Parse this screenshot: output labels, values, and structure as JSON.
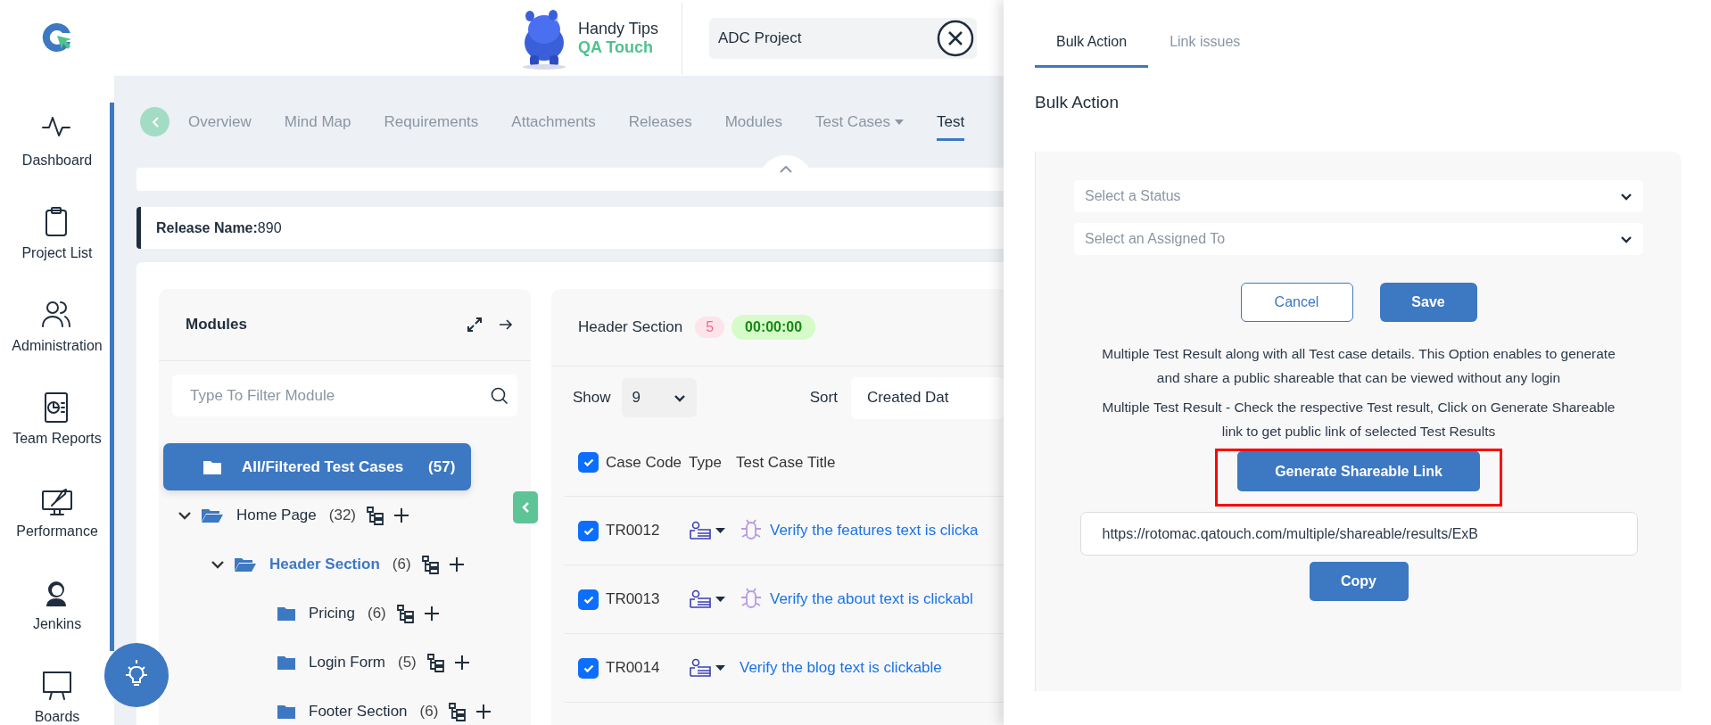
{
  "sidebar": {
    "items": [
      {
        "label": "Dashboard"
      },
      {
        "label": "Project List"
      },
      {
        "label": "Administration"
      },
      {
        "label": "Team Reports"
      },
      {
        "label": "Performance"
      },
      {
        "label": "Jenkins"
      },
      {
        "label": "Boards"
      }
    ]
  },
  "header": {
    "title": "Handy Tips",
    "subtitle": "QA Touch",
    "project_field": {
      "value": "ADC Project"
    }
  },
  "nav_tabs": [
    {
      "label": "Overview",
      "selected": false,
      "dropdown": false
    },
    {
      "label": "Mind Map",
      "selected": false,
      "dropdown": false
    },
    {
      "label": "Requirements",
      "selected": false,
      "dropdown": false
    },
    {
      "label": "Attachments",
      "selected": false,
      "dropdown": false
    },
    {
      "label": "Releases",
      "selected": false,
      "dropdown": false
    },
    {
      "label": "Modules",
      "selected": false,
      "dropdown": false
    },
    {
      "label": "Test Cases",
      "selected": false,
      "dropdown": true
    },
    {
      "label": "Test",
      "selected": true,
      "dropdown": false
    }
  ],
  "release": {
    "label": "Release Name:",
    "value": "890"
  },
  "modules": {
    "title": "Modules",
    "filter": {
      "placeholder": "Type To Filter Module"
    },
    "tree": [
      {
        "kind": "summary",
        "label": "All/Filtered Test Cases",
        "count": "(57)",
        "selected": true
      },
      {
        "kind": "module",
        "label": "Home Page",
        "count": "(32)",
        "selected": false,
        "active": false,
        "expanded": true,
        "children": [
          {
            "kind": "module",
            "label": "Header Section",
            "count": "(6)",
            "selected": false,
            "active": true,
            "expanded": true,
            "children": [
              {
                "kind": "module",
                "label": "Pricing",
                "count": "(6)",
                "selected": false,
                "active": false
              },
              {
                "kind": "module",
                "label": "Login Form",
                "count": "(5)",
                "selected": false,
                "active": false
              },
              {
                "kind": "module",
                "label": "Footer Section",
                "count": "(6)",
                "selected": false,
                "active": false
              }
            ]
          }
        ]
      }
    ]
  },
  "test_list": {
    "title": "Header Section",
    "count": "5",
    "timer": "00:00:00",
    "show": {
      "label": "Show",
      "value": "9"
    },
    "sort": {
      "label": "Sort",
      "value": "Created Dat"
    },
    "header_checked": true,
    "columns": [
      "Case Code",
      "Type",
      "Test Case Title"
    ],
    "rows": [
      {
        "code": "TR0012",
        "checked": true,
        "bug": true,
        "title": "Verify the features text is clicka"
      },
      {
        "code": "TR0013",
        "checked": true,
        "bug": true,
        "title": "Verify the about text is clickabl"
      },
      {
        "code": "TR0014",
        "checked": true,
        "bug": false,
        "title": "Verify the blog text is clickable"
      }
    ]
  },
  "drawer": {
    "tabs": [
      {
        "label": "Bulk Action",
        "selected": true
      },
      {
        "label": "Link issues",
        "selected": false
      }
    ],
    "title": "Bulk Action",
    "status_select": {
      "placeholder": "Select a Status"
    },
    "assignee_select": {
      "placeholder": "Select an Assigned To"
    },
    "cancel_button": "Cancel",
    "save_button": "Save",
    "paragraphs": [
      "Multiple Test Result along with all Test case details. This Option enables to generate and share a public shareable that can be viewed without any login",
      "Multiple Test Result - Check the respective Test result, Click on Generate Shareable link to get public link of selected Test Results"
    ],
    "generate_button": "Generate Shareable Link",
    "generate_highlighted": true,
    "link_field": {
      "value": "https://rotomac.qatouch.com/multiple/shareable/results/ExB"
    },
    "copy_button": "Copy"
  }
}
